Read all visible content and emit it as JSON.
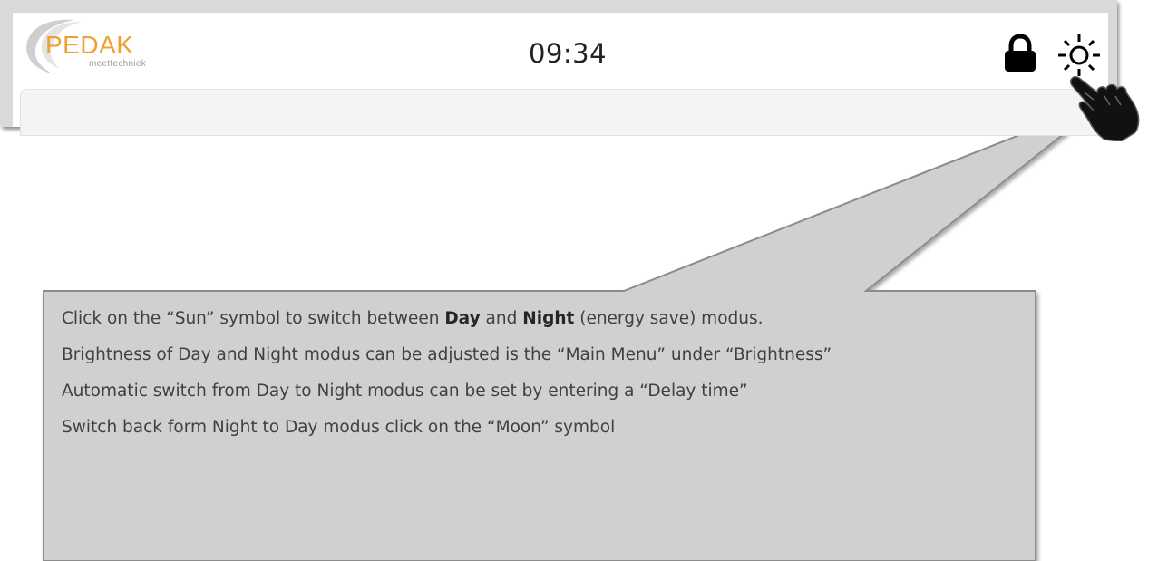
{
  "header": {
    "logo": {
      "name": "PEDAK",
      "subtitle": "meettechniek"
    },
    "clock": "09:34",
    "lock_icon": "lock-icon",
    "sun_icon": "sun-icon"
  },
  "callout": {
    "line1_prefix": "Click on the “Sun” symbol to switch between ",
    "line1_day": "Day",
    "line1_and": " and ",
    "line1_night": "Night",
    "line1_suffix": " (energy save) modus.",
    "line2": "Brightness of Day and Night modus can be adjusted is the “Main Menu” under “Brightness”",
    "line3": "Automatic switch from Day to Night modus can be set by entering a “Delay time”",
    "line4": "Switch back form Night to Day modus click on the “Moon” symbol"
  },
  "colors": {
    "brand_orange": "#f0a030",
    "callout_fill": "#d0d0d0",
    "callout_border": "#8c8c8c"
  }
}
